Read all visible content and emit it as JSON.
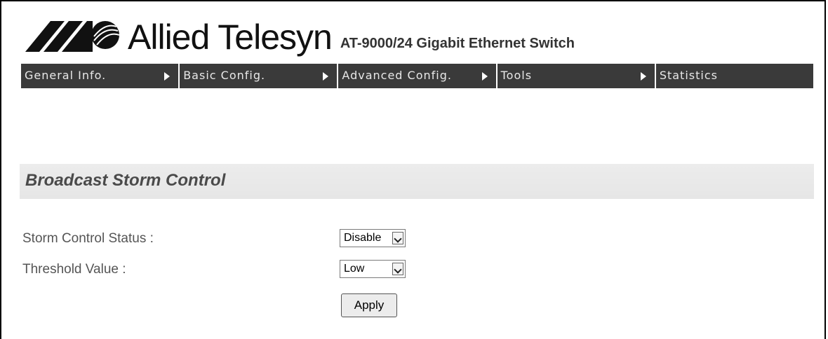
{
  "header": {
    "brand": "Allied Telesyn",
    "product": "AT-9000/24 Gigabit Ethernet Switch"
  },
  "nav": {
    "items": [
      {
        "label": "General Info."
      },
      {
        "label": "Basic Config."
      },
      {
        "label": "Advanced Config."
      },
      {
        "label": "Tools"
      },
      {
        "label": "Statistics"
      }
    ]
  },
  "page": {
    "title": "Broadcast Storm Control"
  },
  "form": {
    "storm_status_label": "Storm Control Status :",
    "storm_status_value": "Disable",
    "threshold_label": "Threshold Value :",
    "threshold_value": "Low",
    "apply_label": "Apply"
  },
  "colors": {
    "nav_bg": "#3a3a3a",
    "section_bg": "#e8e8e8"
  }
}
